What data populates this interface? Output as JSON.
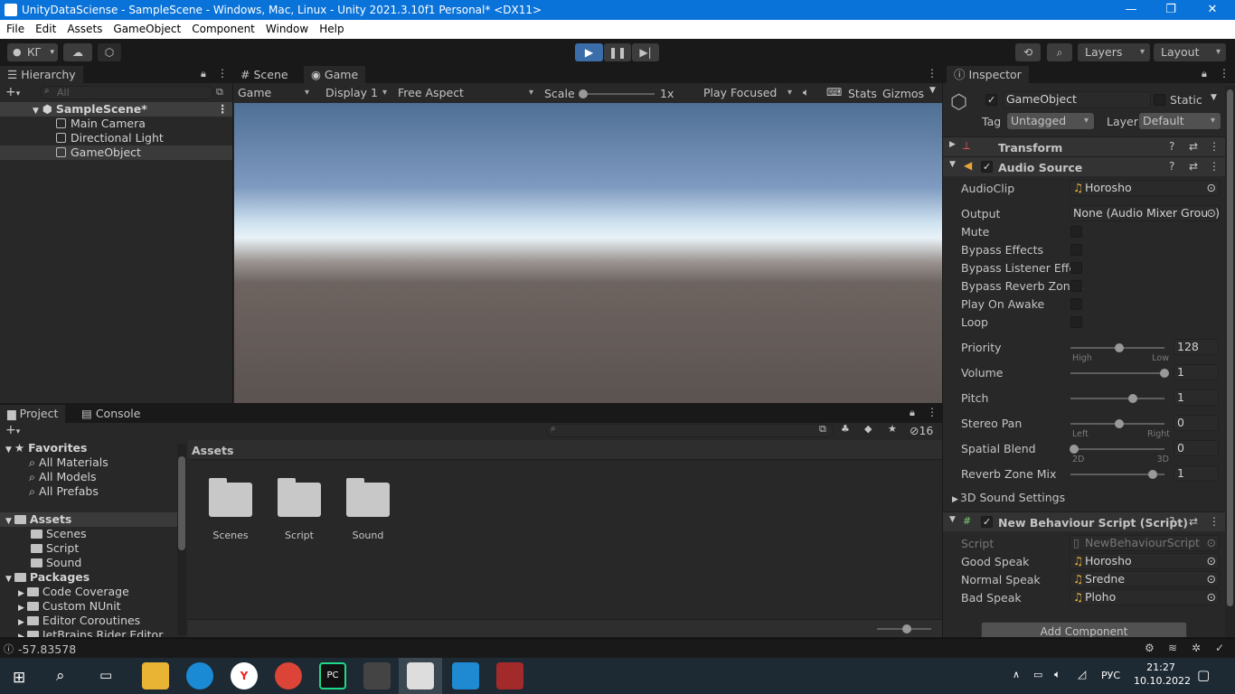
{
  "window": {
    "title": "UnityDataSciense - SampleScene - Windows, Mac, Linux - Unity 2021.3.10f1 Personal* <DX11>"
  },
  "menu": [
    "File",
    "Edit",
    "Assets",
    "GameObject",
    "Component",
    "Window",
    "Help"
  ],
  "toolbar": {
    "account": "КГ",
    "layers": "Layers",
    "layout": "Layout"
  },
  "hierarchy": {
    "tab": "Hierarchy",
    "search_placeholder": "All",
    "scene": "SampleScene*",
    "items": [
      "Main Camera",
      "Directional Light",
      "GameObject"
    ]
  },
  "game_view": {
    "tabs": [
      "Scene",
      "Game"
    ],
    "mode": "Game",
    "display": "Display 1",
    "aspect": "Free Aspect",
    "scale_label": "Scale",
    "scale_value": "1x",
    "play_mode": "Play Focused",
    "stats": "Stats",
    "gizmos": "Gizmos"
  },
  "project": {
    "tabs": [
      "Project",
      "Console"
    ],
    "hidden_count": "16",
    "favorites_label": "Favorites",
    "favorites": [
      "All Materials",
      "All Models",
      "All Prefabs"
    ],
    "assets_label": "Assets",
    "asset_folders": [
      "Scenes",
      "Script",
      "Sound"
    ],
    "packages_label": "Packages",
    "packages": [
      "Code Coverage",
      "Custom NUnit",
      "Editor Coroutines",
      "JetBrains Rider Editor"
    ],
    "breadcrumb": "Assets",
    "grid_items": [
      "Scenes",
      "Script",
      "Sound"
    ]
  },
  "inspector": {
    "tab": "Inspector",
    "object_name": "GameObject",
    "static_label": "Static",
    "tag_label": "Tag",
    "tag_value": "Untagged",
    "layer_label": "Layer",
    "layer_value": "Default",
    "transform_label": "Transform",
    "audio_source": {
      "title": "Audio Source",
      "audioclip_label": "AudioClip",
      "audioclip_value": "Horosho",
      "output_label": "Output",
      "output_value": "None (Audio Mixer Group)",
      "toggles": [
        {
          "label": "Mute",
          "checked": false
        },
        {
          "label": "Bypass Effects",
          "checked": false
        },
        {
          "label": "Bypass Listener Effec",
          "checked": false
        },
        {
          "label": "Bypass Reverb Zones",
          "checked": false
        },
        {
          "label": "Play On Awake",
          "checked": false
        },
        {
          "label": "Loop",
          "checked": false
        }
      ],
      "sliders": [
        {
          "label": "Priority",
          "value": "128",
          "fraction": 0.5,
          "min_label": "High",
          "max_label": "Low"
        },
        {
          "label": "Volume",
          "value": "1",
          "fraction": 1.0,
          "min_label": "",
          "max_label": ""
        },
        {
          "label": "Pitch",
          "value": "1",
          "fraction": 0.65,
          "min_label": "",
          "max_label": ""
        },
        {
          "label": "Stereo Pan",
          "value": "0",
          "fraction": 0.5,
          "min_label": "Left",
          "max_label": "Right"
        },
        {
          "label": "Spatial Blend",
          "value": "0",
          "fraction": 0.0,
          "min_label": "2D",
          "max_label": "3D"
        },
        {
          "label": "Reverb Zone Mix",
          "value": "1",
          "fraction": 0.87,
          "min_label": "",
          "max_label": ""
        }
      ],
      "sound_settings": "3D Sound Settings"
    },
    "script": {
      "title": "New Behaviour Script (Script)",
      "script_label": "Script",
      "script_value": "NewBehaviourScript",
      "fields": [
        {
          "label": "Good Speak",
          "value": "Horosho"
        },
        {
          "label": "Normal Speak",
          "value": "Sredne"
        },
        {
          "label": "Bad Speak",
          "value": "Ploho"
        }
      ]
    },
    "add_component": "Add Component"
  },
  "statusbar": {
    "message": "-57.83578"
  },
  "taskbar": {
    "language": "РУС",
    "time": "21:27",
    "date": "10.10.2022"
  }
}
